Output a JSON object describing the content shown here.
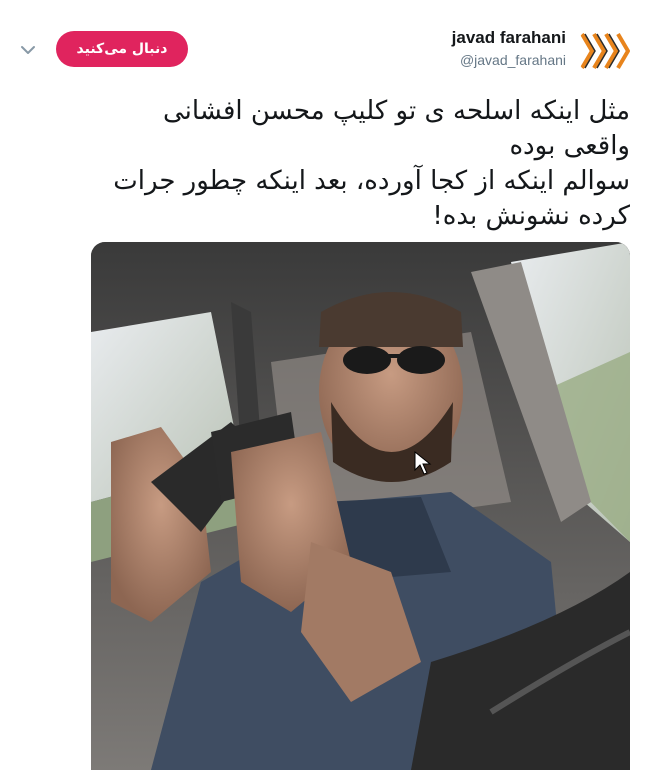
{
  "header": {
    "more_icon": "chevron-down-icon",
    "follow_label": "دنبال می‌کنید",
    "display_name": "javad farahani",
    "handle": "@javad_farahani",
    "avatar_icon": "stacked-chevrons-logo"
  },
  "tweet": {
    "lines": [
      "مثل اینکه اسلحه ی تو کلیپ محسن افشانی",
      "واقعی بوده",
      "سوالم اینکه از کجا آورده، بعد اینکه چطور جرات",
      "کرده نشونش بده!"
    ]
  },
  "media": {
    "kind": "video-frame",
    "subject": "man in sunglasses holding a pistol inside a car"
  },
  "colors": {
    "follow_button": "#e0245e",
    "name_text": "#14171a",
    "handle_text": "#657786",
    "logo_orange": "#e8841c"
  }
}
